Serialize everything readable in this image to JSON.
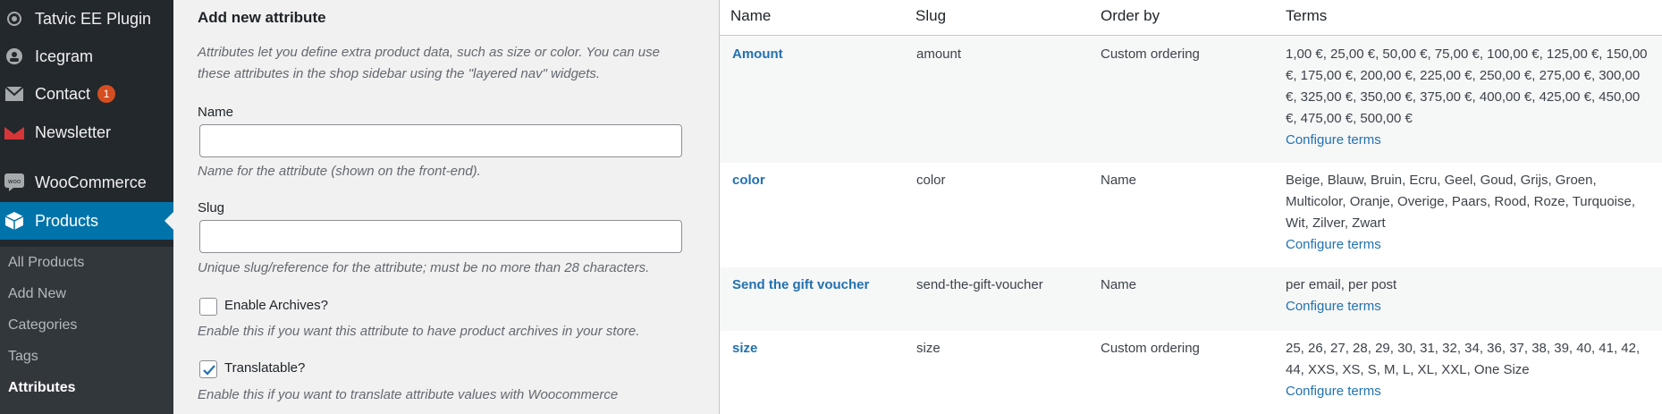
{
  "sidebar": {
    "items": [
      {
        "label": "Tatvic EE Plugin",
        "icon": "tatvic-icon"
      },
      {
        "label": "Icegram",
        "icon": "icegram-icon"
      },
      {
        "label": "Contact",
        "icon": "mail-icon",
        "badge": "1"
      },
      {
        "label": "Newsletter",
        "icon": "newsletter-icon"
      },
      {
        "label": "WooCommerce",
        "icon": "woocommerce-icon"
      },
      {
        "label": "Products",
        "icon": "products-icon"
      }
    ],
    "submenu": [
      "All Products",
      "Add New",
      "Categories",
      "Tags",
      "Attributes"
    ]
  },
  "form": {
    "title": "Add new attribute",
    "intro_line1": "Attributes let you define extra product data, such as size or color. You can use",
    "intro_line2": "these attributes in the shop sidebar using the \"layered nav\" widgets.",
    "name_label": "Name",
    "name_value": "",
    "name_desc": "Name for the attribute (shown on the front-end).",
    "slug_label": "Slug",
    "slug_value": "",
    "slug_desc": "Unique slug/reference for the attribute; must be no more than 28 characters.",
    "archives_label": "Enable Archives?",
    "archives_checked": false,
    "archives_desc": "Enable this if you want this attribute to have product archives in your store.",
    "translatable_label": "Translatable?",
    "translatable_checked": true,
    "translatable_desc": "Enable this if you want to translate attribute values with Woocommerce"
  },
  "table": {
    "headers": [
      "Name",
      "Slug",
      "Order by",
      "Terms"
    ],
    "configure_label": "Configure terms",
    "rows": [
      {
        "name": "Amount",
        "slug": "amount",
        "order": "Custom ordering",
        "terms_lines": [
          "1,00 €, 25,00 €, 50,00 €, 75,00 €, 100,00 €, 125,00 €, 150,00",
          "€, 175,00 €, 200,00 €, 225,00 €, 250,00 €, 275,00 €, 300,00",
          "€, 325,00 €, 350,00 €, 375,00 €, 400,00 €, 425,00 €, 450,00",
          "€, 475,00 €, 500,00 €"
        ]
      },
      {
        "name": "color",
        "slug": "color",
        "order": "Name",
        "terms_lines": [
          "Beige, Blauw, Bruin, Ecru, Geel, Goud, Grijs, Groen,",
          "Multicolor, Oranje, Overige, Paars, Rood, Roze, Turquoise,",
          "Wit, Zilver, Zwart"
        ]
      },
      {
        "name": "Send the gift voucher",
        "slug": "send-the-gift-voucher",
        "order": "Name",
        "terms_lines": [
          "per email, per post"
        ]
      },
      {
        "name": "size",
        "slug": "size",
        "order": "Custom ordering",
        "terms_lines": [
          "25, 26, 27, 28, 29, 30, 31, 32, 34, 36, 37, 38, 39, 40, 41, 42,",
          "44, XXS, XS, S, M, L, XL, XXL, One Size"
        ]
      }
    ]
  }
}
